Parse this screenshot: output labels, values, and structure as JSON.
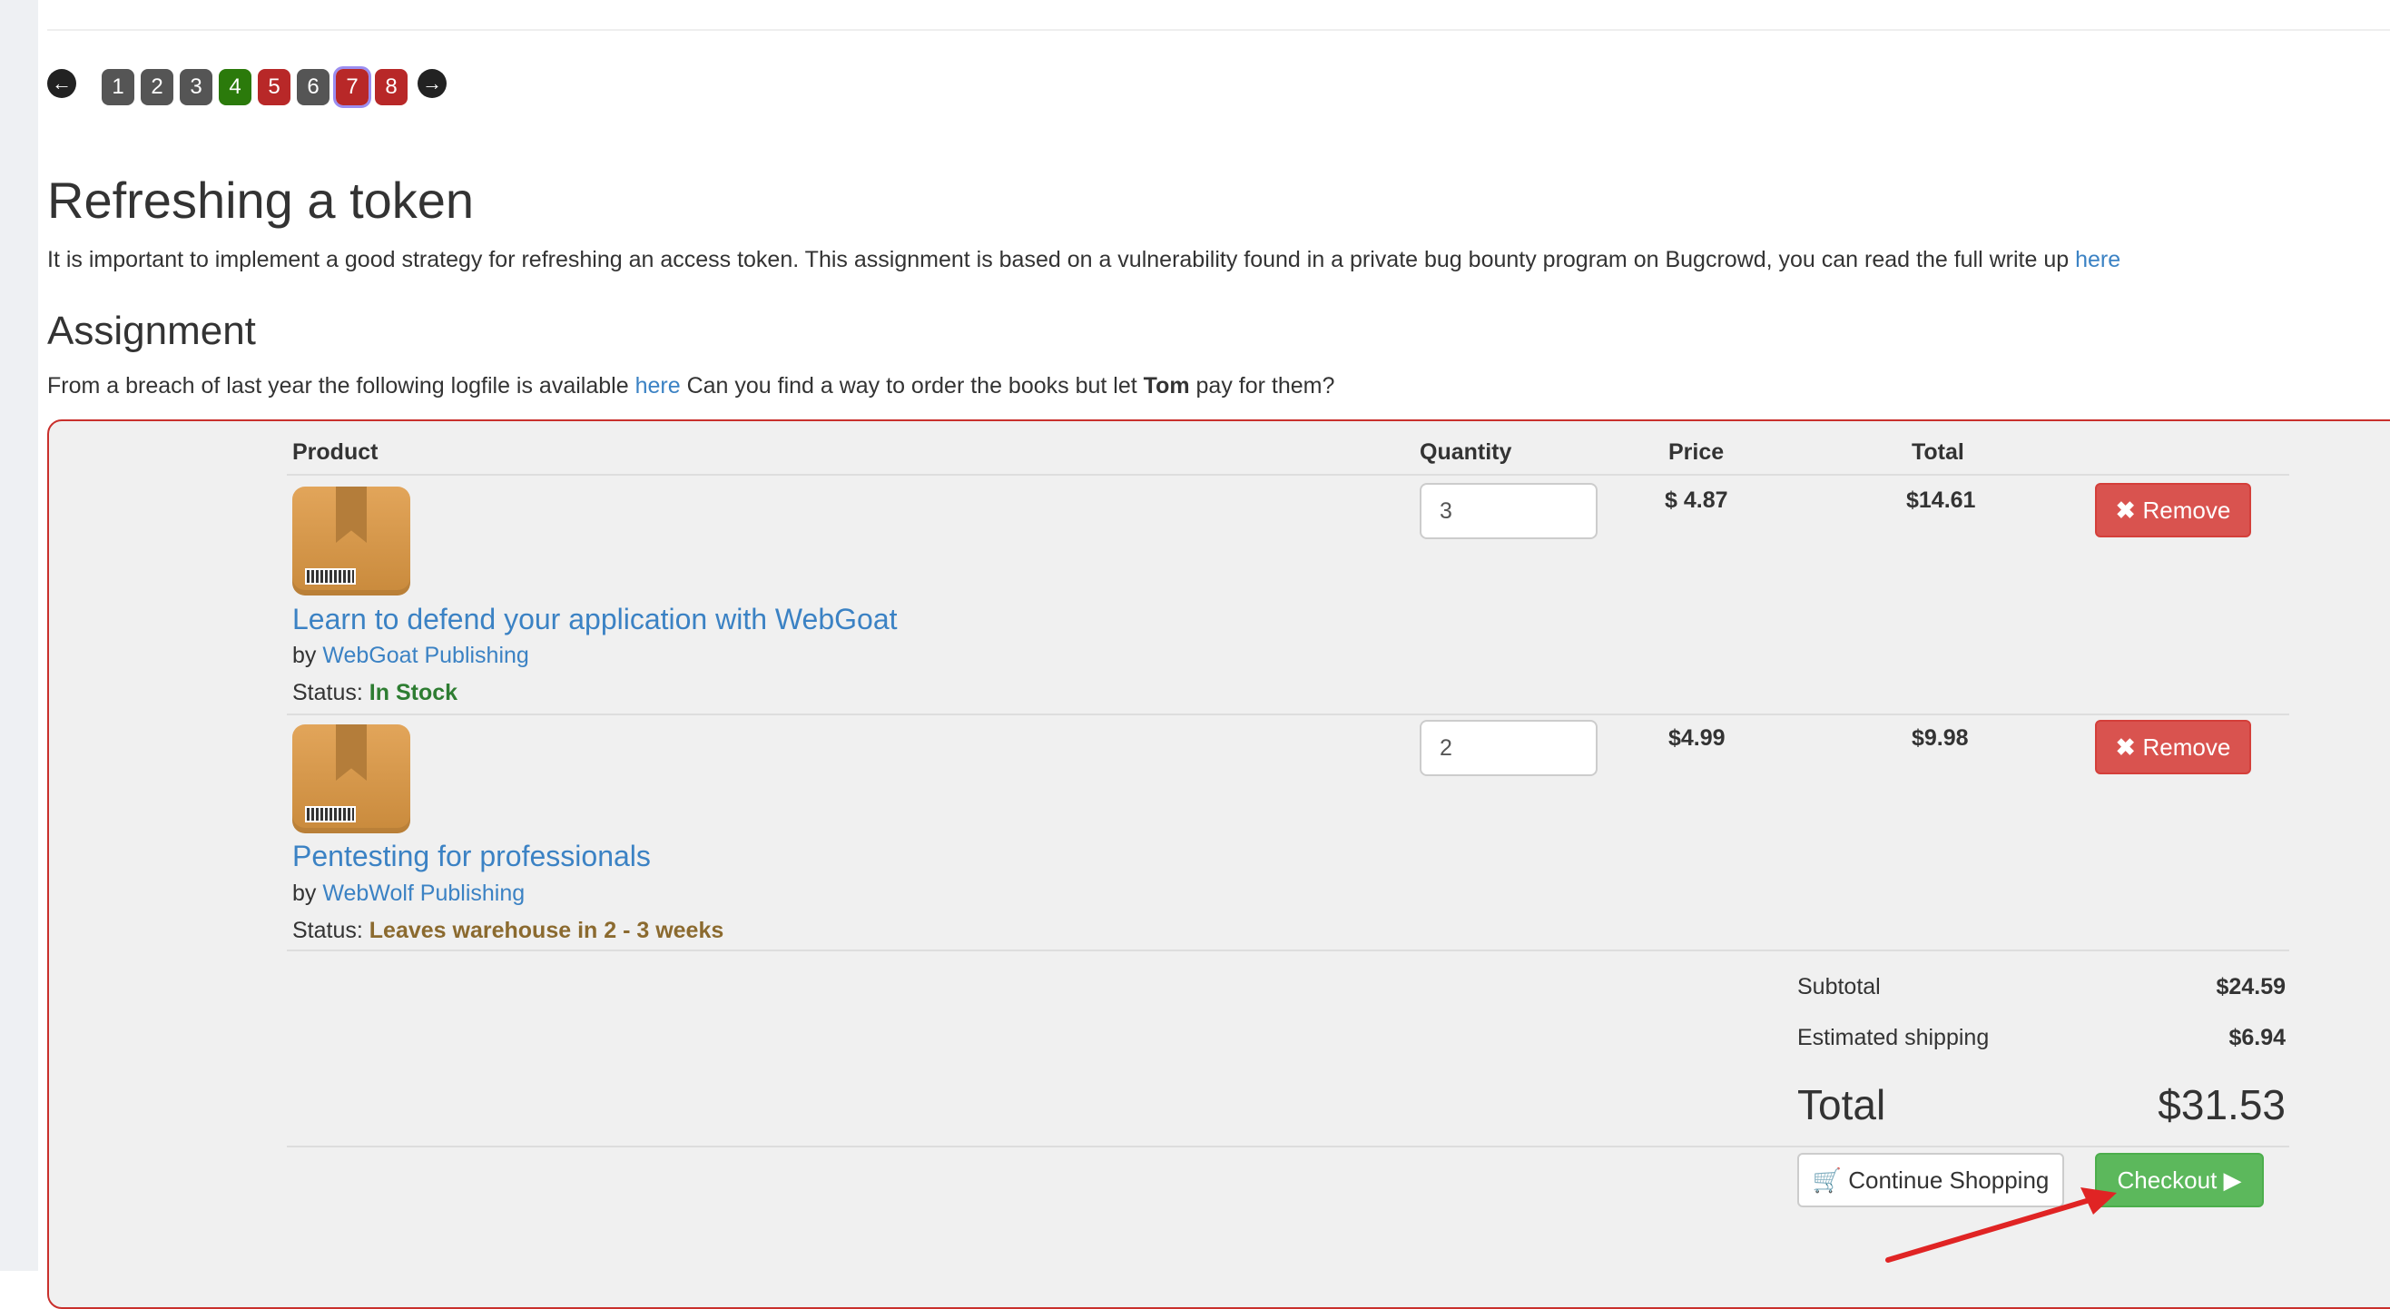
{
  "pager": {
    "prev_icon": "arrow-left-icon",
    "next_icon": "arrow-right-icon",
    "pages": [
      {
        "label": "1",
        "state": "default",
        "color": "#555555"
      },
      {
        "label": "2",
        "state": "default",
        "color": "#555555"
      },
      {
        "label": "3",
        "state": "default",
        "color": "#555555"
      },
      {
        "label": "4",
        "state": "solved",
        "color": "#2b7a0b"
      },
      {
        "label": "5",
        "state": "failed",
        "color": "#b82828"
      },
      {
        "label": "6",
        "state": "default",
        "color": "#555555"
      },
      {
        "label": "7",
        "state": "current",
        "color": "#b82828"
      },
      {
        "label": "8",
        "state": "failed",
        "color": "#b82828"
      }
    ]
  },
  "lesson": {
    "title": "Refreshing a token",
    "intro_text": "It is important to implement a good strategy for refreshing an access token. This assignment is based on a vulnerability found in a private bug bounty program on Bugcrowd, you can read the full write up",
    "intro_link": "here"
  },
  "assignment": {
    "title": "Assignment",
    "text_before": "From a breach of last year the following logfile is available",
    "link": "here",
    "text_middle": "Can you find a way to order the books but let",
    "bold_name": "Tom",
    "text_after": "pay for them?"
  },
  "cart": {
    "headers": {
      "product": "Product",
      "quantity": "Quantity",
      "price": "Price",
      "total": "Total"
    },
    "items": [
      {
        "title": "Learn to defend your application with WebGoat",
        "by_label": "by",
        "publisher": "WebGoat Publishing",
        "status_label": "Status:",
        "status": "In Stock",
        "quantity": "3",
        "price": "$ 4.87",
        "total": "$14.61",
        "remove_label": "Remove"
      },
      {
        "title": "Pentesting for professionals",
        "by_label": "by",
        "publisher": "WebWolf Publishing",
        "status_label": "Status:",
        "status": "Leaves warehouse in 2 - 3 weeks",
        "quantity": "2",
        "price": "$4.99",
        "total": "$9.98",
        "remove_label": "Remove"
      }
    ],
    "summary": {
      "subtotal_label": "Subtotal",
      "subtotal": "$24.59",
      "shipping_label": "Estimated shipping",
      "shipping": "$6.94",
      "total_label": "Total",
      "total": "$31.53"
    },
    "continue_label": "Continue Shopping",
    "checkout_label": "Checkout"
  },
  "colors": {
    "link": "#3b82c4",
    "remove": "#d9534f",
    "checkout": "#5cb85c",
    "panel_border": "#c9302c",
    "annotation_arrow": "#e02424"
  }
}
